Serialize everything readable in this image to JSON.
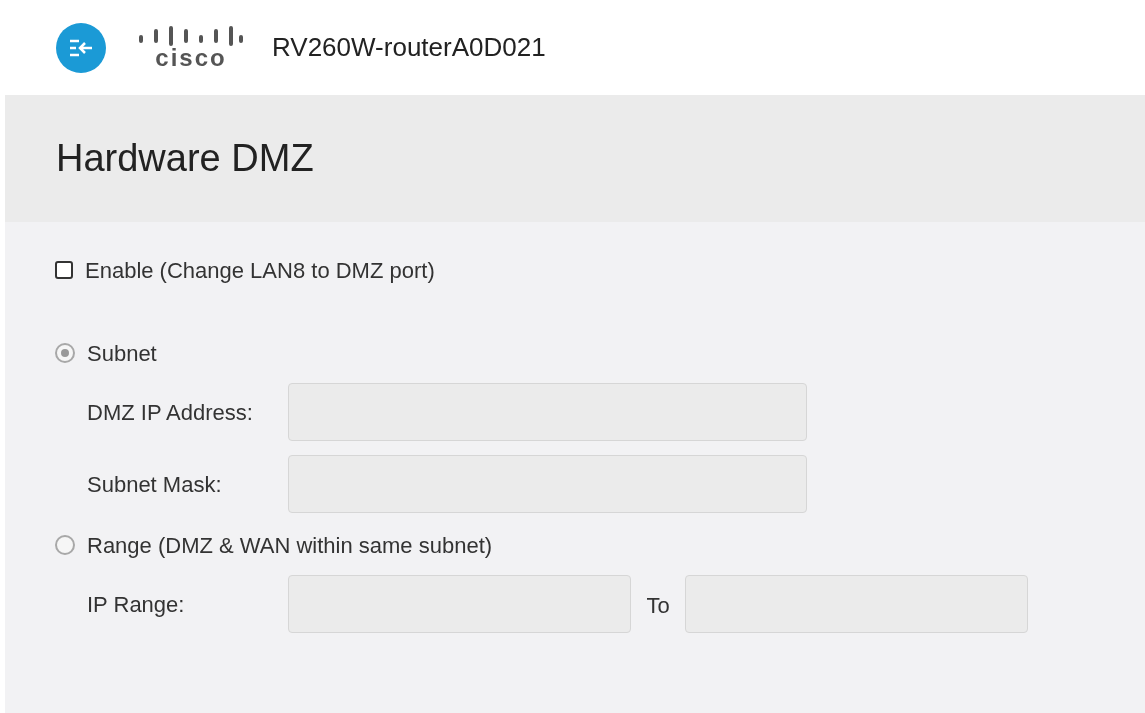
{
  "header": {
    "logo_text": "cisco",
    "device_name": "RV260W-routerA0D021"
  },
  "page": {
    "title": "Hardware DMZ"
  },
  "enable": {
    "label": "Enable (Change LAN8 to DMZ port)",
    "checked": false
  },
  "options": [
    {
      "label": "Subnet",
      "selected": true,
      "disabled": true,
      "fields": [
        {
          "label": "DMZ IP Address:",
          "inputs": [
            {
              "disabled": true
            }
          ]
        },
        {
          "label": "Subnet Mask:",
          "inputs": [
            {
              "disabled": true
            }
          ]
        }
      ]
    },
    {
      "label": "Range (DMZ & WAN within same subnet)",
      "selected": false,
      "disabled": true,
      "fields": [
        {
          "label": "IP Range:",
          "separator": "To",
          "inputs": [
            {
              "disabled": true
            },
            {
              "disabled": true
            }
          ]
        }
      ]
    }
  ]
}
